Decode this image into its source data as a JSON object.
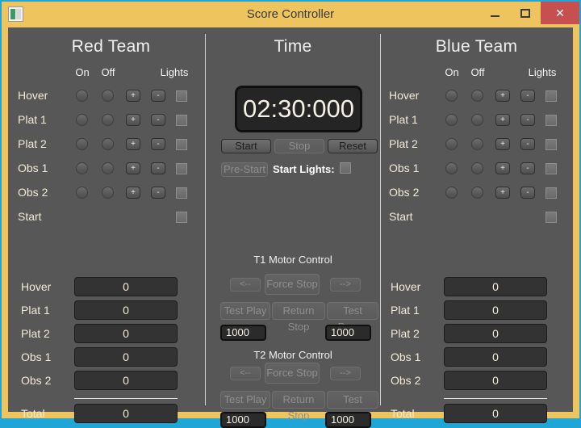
{
  "window": {
    "title": "Score Controller",
    "app_icon": "app-window-icon",
    "minimize": "–",
    "maximize": "□",
    "close": "✕",
    "frame_color": "#edc45e",
    "outer_border_color": "#1fa6d6",
    "client_color": "#575757",
    "close_button_color": "#c6504f"
  },
  "red_team": {
    "title": "Red Team",
    "columns": [
      "On",
      "Off",
      "Lights"
    ],
    "rows": [
      {
        "label": "Hover",
        "plus": "+",
        "minus": "-"
      },
      {
        "label": "Plat 1",
        "plus": "+",
        "minus": "-"
      },
      {
        "label": "Plat 2",
        "plus": "+",
        "minus": "-"
      },
      {
        "label": "Obs 1",
        "plus": "+",
        "minus": "-"
      },
      {
        "label": "Obs 2",
        "plus": "+",
        "minus": "-"
      }
    ],
    "start_row_label": "Start",
    "scores": [
      {
        "label": "Hover",
        "value": "0"
      },
      {
        "label": "Plat 1",
        "value": "0"
      },
      {
        "label": "Plat 2",
        "value": "0"
      },
      {
        "label": "Obs 1",
        "value": "0"
      },
      {
        "label": "Obs 2",
        "value": "0"
      }
    ],
    "total_label": "Total",
    "total_value": "0"
  },
  "blue_team": {
    "title": "Blue Team",
    "columns": [
      "On",
      "Off",
      "Lights"
    ],
    "rows": [
      {
        "label": "Hover",
        "plus": "+",
        "minus": "-"
      },
      {
        "label": "Plat 1",
        "plus": "+",
        "minus": "-"
      },
      {
        "label": "Plat 2",
        "plus": "+",
        "minus": "-"
      },
      {
        "label": "Obs 1",
        "plus": "+",
        "minus": "-"
      },
      {
        "label": "Obs 2",
        "plus": "+",
        "minus": "-"
      }
    ],
    "start_row_label": "Start",
    "scores": [
      {
        "label": "Hover",
        "value": "0"
      },
      {
        "label": "Plat 1",
        "value": "0"
      },
      {
        "label": "Plat 2",
        "value": "0"
      },
      {
        "label": "Obs 1",
        "value": "0"
      },
      {
        "label": "Obs 2",
        "value": "0"
      }
    ],
    "total_label": "Total",
    "total_value": "0"
  },
  "time_panel": {
    "title": "Time",
    "display": "02:30:000",
    "start_label": "Start",
    "stop_label": "Stop",
    "reset_label": "Reset",
    "prestart_label": "Pre-Start",
    "start_lights_label": "Start Lights:"
  },
  "motor_t1": {
    "title": "T1 Motor Control",
    "left_label": "<--",
    "force_stop_label": "Force Stop",
    "right_label": "-->",
    "test_play_label": "Test Play",
    "return_stop_label": "Return Stop",
    "test_pause_label": "Test Pause",
    "left_value": "1000",
    "right_value": "1000"
  },
  "motor_t2": {
    "title": "T2 Motor Control",
    "left_label": "<--",
    "force_stop_label": "Force Stop",
    "right_label": "-->",
    "test_play_label": "Test Play",
    "return_stop_label": "Return Stop",
    "test_pause_label": "Test Pause",
    "left_value": "1000",
    "right_value": "1000"
  }
}
